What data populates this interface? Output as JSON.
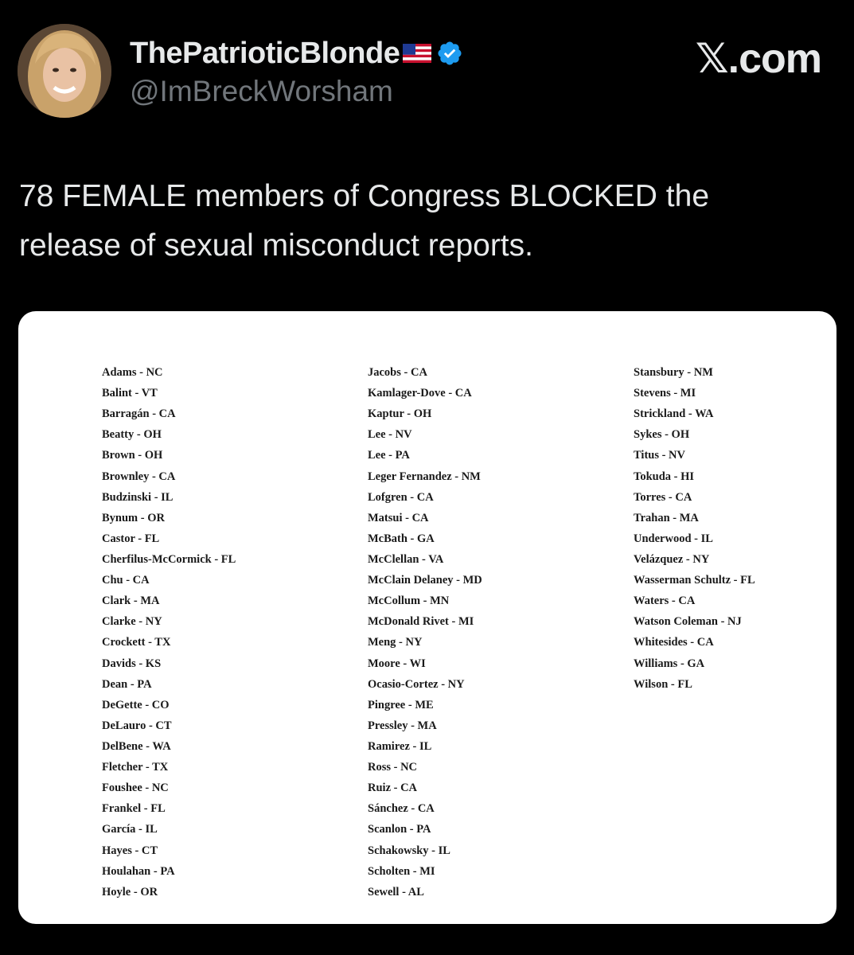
{
  "author": {
    "display_name": "ThePatrioticBlonde",
    "handle": "@ImBreckWorsham",
    "flag_icon": "us-flag-icon",
    "verified_icon": "verified-badge-icon",
    "verified_color": "#1d9bf0"
  },
  "brand": {
    "label": "𝕏.com"
  },
  "tweet": {
    "line1": "78 FEMALE members of Congress BLOCKED the",
    "line2": "release of sexual misconduct reports."
  },
  "list": {
    "col1": [
      "Adams - NC",
      "Balint - VT",
      "Barragán - CA",
      "Beatty - OH",
      "Brown - OH",
      "Brownley - CA",
      "Budzinski - IL",
      "Bynum - OR",
      "Castor - FL",
      "Cherfilus-McCormick - FL",
      "Chu - CA",
      "Clark - MA",
      "Clarke - NY",
      "Crockett - TX",
      "Davids - KS",
      "Dean - PA",
      "DeGette - CO",
      "DeLauro - CT",
      "DelBene - WA",
      "Fletcher - TX",
      "Foushee - NC",
      "Frankel - FL",
      "García - IL",
      "Hayes - CT",
      "Houlahan - PA",
      "Hoyle - OR"
    ],
    "col2": [
      "Jacobs - CA",
      "Kamlager-Dove - CA",
      "Kaptur - OH",
      "Lee - NV",
      "Lee - PA",
      "Leger Fernandez - NM",
      "Lofgren - CA",
      "Matsui - CA",
      "McBath - GA",
      "McClellan - VA",
      "McClain Delaney - MD",
      "McCollum - MN",
      "McDonald Rivet - MI",
      "Meng - NY",
      "Moore - WI",
      "Ocasio-Cortez - NY",
      "Pingree - ME",
      "Pressley - MA",
      "Ramirez - IL",
      "Ross - NC",
      "Ruiz - CA",
      "Sánchez - CA",
      "Scanlon - PA",
      "Schakowsky - IL",
      "Scholten - MI",
      "Sewell - AL"
    ],
    "col3": [
      "Stansbury - NM",
      "Stevens - MI",
      "Strickland - WA",
      "Sykes - OH",
      "Titus - NV",
      "Tokuda - HI",
      "Torres - CA",
      "Trahan - MA",
      "Underwood - IL",
      "Velázquez - NY",
      "Wasserman Schultz - FL",
      "Waters - CA",
      "Watson Coleman - NJ",
      "Whitesides - CA",
      "Williams - GA",
      "Wilson - FL"
    ]
  }
}
